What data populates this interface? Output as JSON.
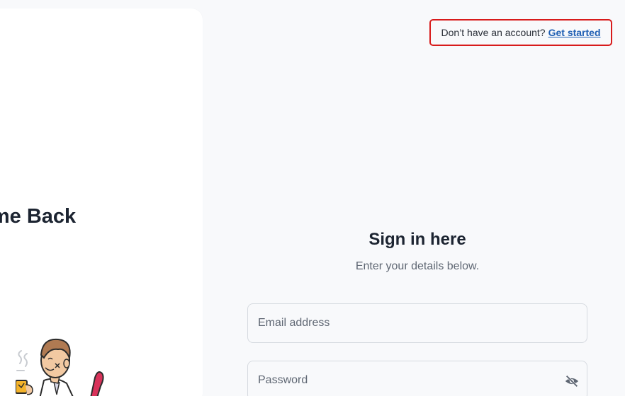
{
  "welcome_panel": {
    "title": "Welcome Back",
    "illustration_icon": "man-with-coffee-illustration"
  },
  "signup_prompt": {
    "text": "Don’t have an account?",
    "link_label": "Get started"
  },
  "form": {
    "heading": "Sign in here",
    "subheading": "Enter your details below.",
    "email_placeholder": "Email address",
    "password_placeholder": "Password",
    "password_toggle_icon": "eye-off-icon"
  },
  "colors": {
    "background": "#f8f9fb",
    "panel": "#ffffff",
    "link": "#1f5fb3",
    "highlight_border": "#d81b1b",
    "text_primary": "#1c2431",
    "text_secondary": "#5f6773"
  }
}
